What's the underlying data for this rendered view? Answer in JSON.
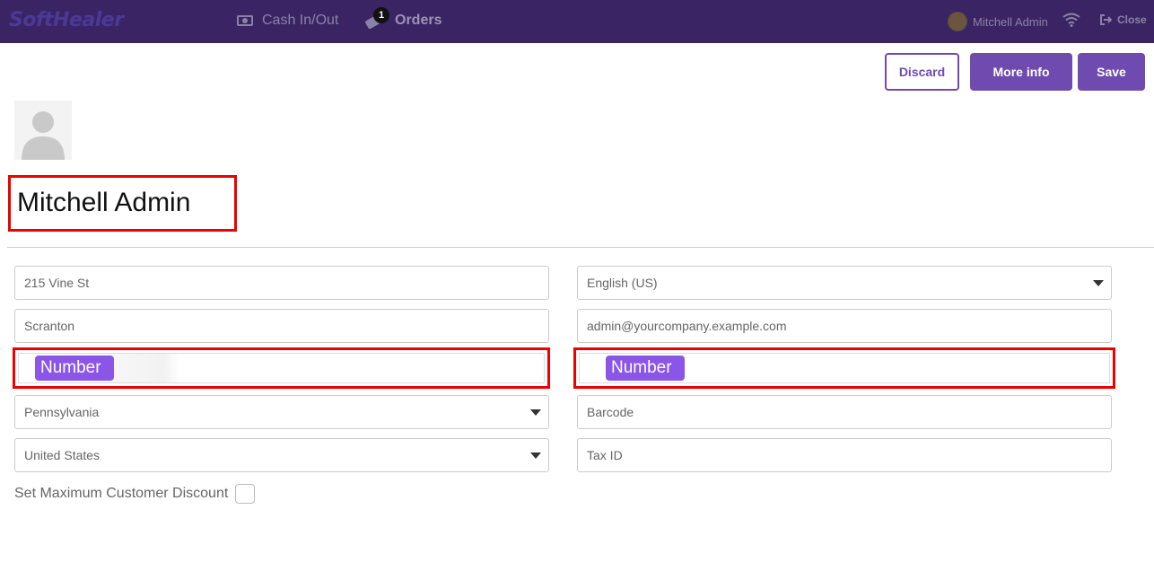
{
  "header": {
    "logo": "SoftHealer",
    "nav": {
      "cash_label": "Cash In/Out",
      "orders_label": "Orders",
      "orders_badge": "1"
    },
    "user_name": "Mitchell Admin",
    "close_label": "Close"
  },
  "actions": {
    "discard": "Discard",
    "more_info": "More info",
    "save": "Save"
  },
  "customer": {
    "name": "Mitchell Admin"
  },
  "fields_left": {
    "street": "215 Vine St",
    "city": "Scranton",
    "zip_placeholder": "Number",
    "state": "Pennsylvania",
    "country": "United States"
  },
  "fields_right": {
    "language": "English (US)",
    "email": "admin@yourcompany.example.com",
    "phone_placeholder": "Number",
    "barcode_placeholder": "Barcode",
    "taxid_placeholder": "Tax ID"
  },
  "discount_label": "Set Maximum Customer Discount",
  "colors": {
    "topbar": "#3b2464",
    "accent": "#6f4bb0",
    "highlight": "#ee0000",
    "pill": "#8b55e8"
  }
}
